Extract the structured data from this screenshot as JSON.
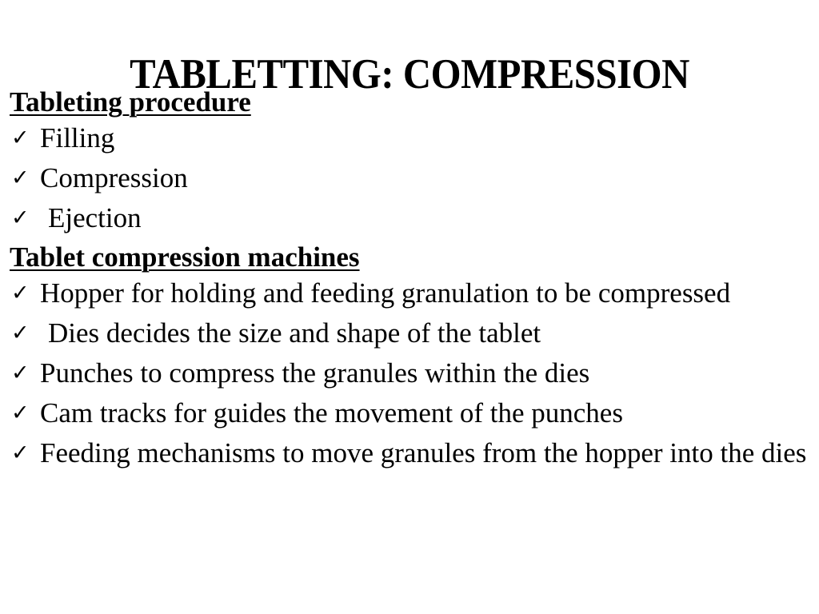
{
  "slide": {
    "title": "TABLETTING: COMPRESSION",
    "sections": [
      {
        "heading": "Tableting procedure",
        "items": [
          {
            "icon": "checkmark-icon",
            "text": "Filling"
          },
          {
            "icon": "checkmark-icon",
            "text": "Compression"
          },
          {
            "icon": "checkmark-icon",
            "text": "Ejection"
          }
        ]
      },
      {
        "heading": "Tablet compression machines",
        "items": [
          {
            "icon": "checkmark-icon",
            "text": "Hopper for holding and feeding granulation to be compressed"
          },
          {
            "icon": "checkmark-icon",
            "text": "Dies decides the size and shape of the tablet"
          },
          {
            "icon": "checkmark-icon",
            "text": "Punches to compress the granules within the dies"
          },
          {
            "icon": "checkmark-icon",
            "text": "Cam tracks for guides the movement of the punches"
          },
          {
            "icon": "checkmark-icon",
            "text": "Feeding mechanisms to move granules from the hopper into the dies"
          }
        ]
      }
    ],
    "check_glyph": "✓"
  }
}
